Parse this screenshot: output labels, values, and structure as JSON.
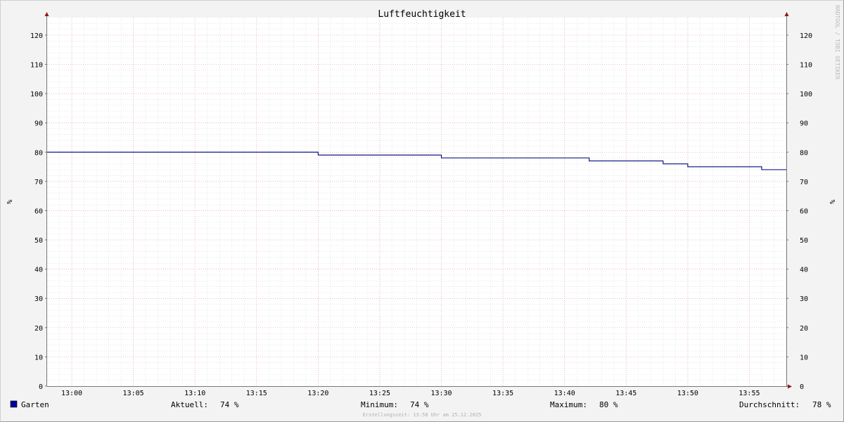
{
  "chart_data": {
    "type": "line",
    "title": "Luftfeuchtigkeit",
    "ylabel": "%",
    "ylabel_right": "%",
    "watermark": "RRDTOOL / TOBI OETIKER",
    "x_ticks": [
      "13:00",
      "13:05",
      "13:10",
      "13:15",
      "13:20",
      "13:25",
      "13:30",
      "13:35",
      "13:40",
      "13:45",
      "13:50",
      "13:55"
    ],
    "xlim": [
      "12:58",
      "13:58"
    ],
    "y_ticks": [
      0,
      10,
      20,
      30,
      40,
      50,
      60,
      70,
      80,
      90,
      100,
      110,
      120
    ],
    "ylim": [
      0,
      126
    ],
    "grid": true,
    "series": [
      {
        "name": "Garten",
        "color": "#000080",
        "step": true,
        "x": [
          "12:58",
          "13:20",
          "13:30",
          "13:42",
          "13:48",
          "13:50",
          "13:56",
          "13:58"
        ],
        "y": [
          80,
          79,
          78,
          77,
          76,
          75,
          74,
          74
        ]
      }
    ],
    "legend": {
      "swatch_color": "#0000a0",
      "series_name": "Garten",
      "stats": [
        {
          "label": "Aktuell:",
          "value": "74 %"
        },
        {
          "label": "Minimum:",
          "value": "74 %"
        },
        {
          "label": "Maximum:",
          "value": "80 %"
        },
        {
          "label": "Durchschnitt:",
          "value": "78 %"
        }
      ]
    },
    "footer": "Erstellungszeit: 13:58 Uhr am 25.12.2025",
    "colors": {
      "background": "#f3f3f3",
      "plot_background": "#ffffff",
      "minor_grid": "#d8d8d8",
      "major_grid": "#e8a0a0",
      "axis": "#777777",
      "arrow": "#8b1a1a",
      "text": "#000000",
      "watermark": "#bbbbbb",
      "footer": "#b0b0b0"
    }
  }
}
